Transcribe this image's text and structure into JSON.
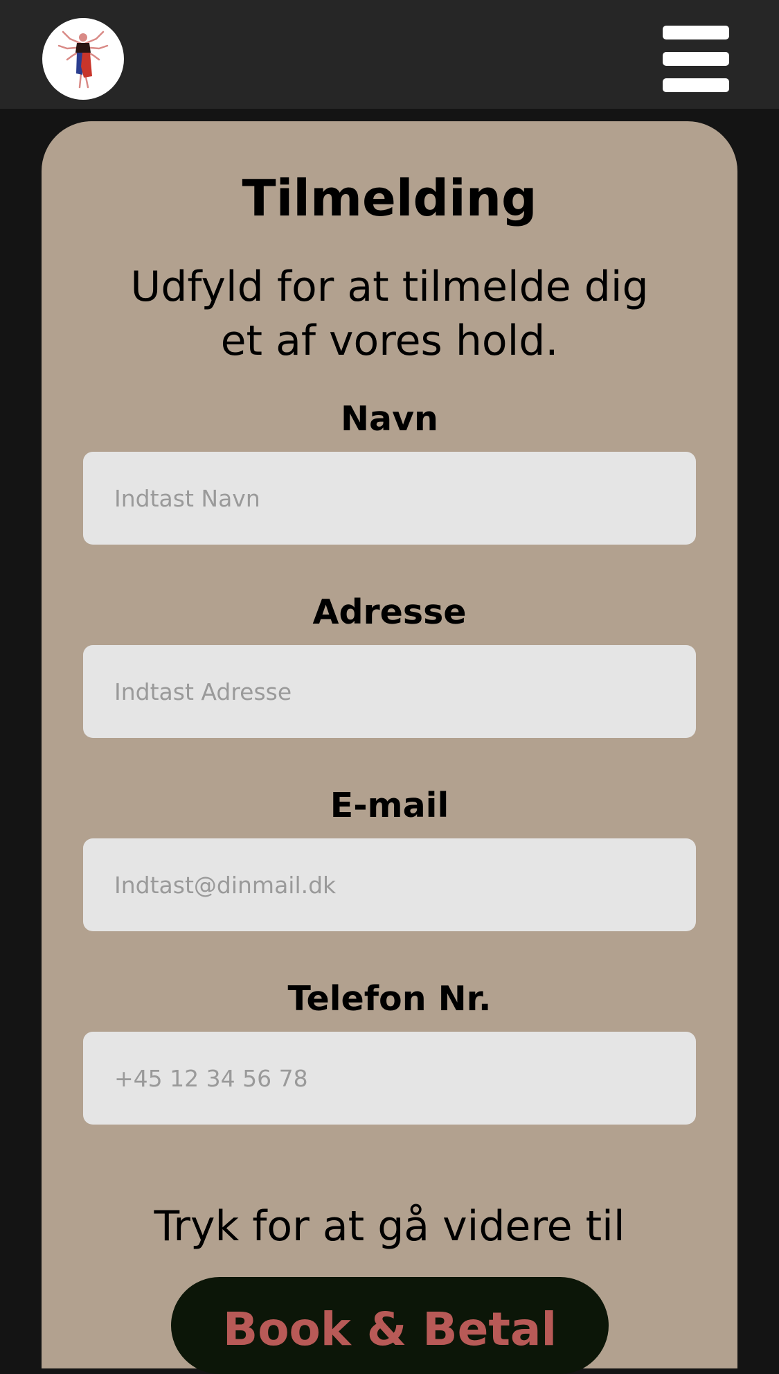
{
  "header": {
    "logo_icon": "dancer-logo-icon",
    "menu_icon": "hamburger-menu-icon"
  },
  "form": {
    "title": "Tilmelding",
    "subtitle": "Udfyld for at tilmelde dig et af vores hold.",
    "fields": [
      {
        "label": "Navn",
        "placeholder": "Indtast Navn",
        "value": ""
      },
      {
        "label": "Adresse",
        "placeholder": "Indtast Adresse",
        "value": ""
      },
      {
        "label": "E-mail",
        "placeholder": "Indtast@dinmail.dk",
        "value": ""
      },
      {
        "label": "Telefon Nr.",
        "placeholder": "+45 12 34 56 78",
        "value": ""
      }
    ],
    "continue_text": "Tryk for at gå videre til",
    "continue_button": "Book & Betal"
  },
  "colors": {
    "page_background": "#141414",
    "header_background": "#262626",
    "card_background": "#b2a18f",
    "input_background": "#e5e5e5",
    "button_background": "#0c1608",
    "button_text": "#b85a57"
  }
}
